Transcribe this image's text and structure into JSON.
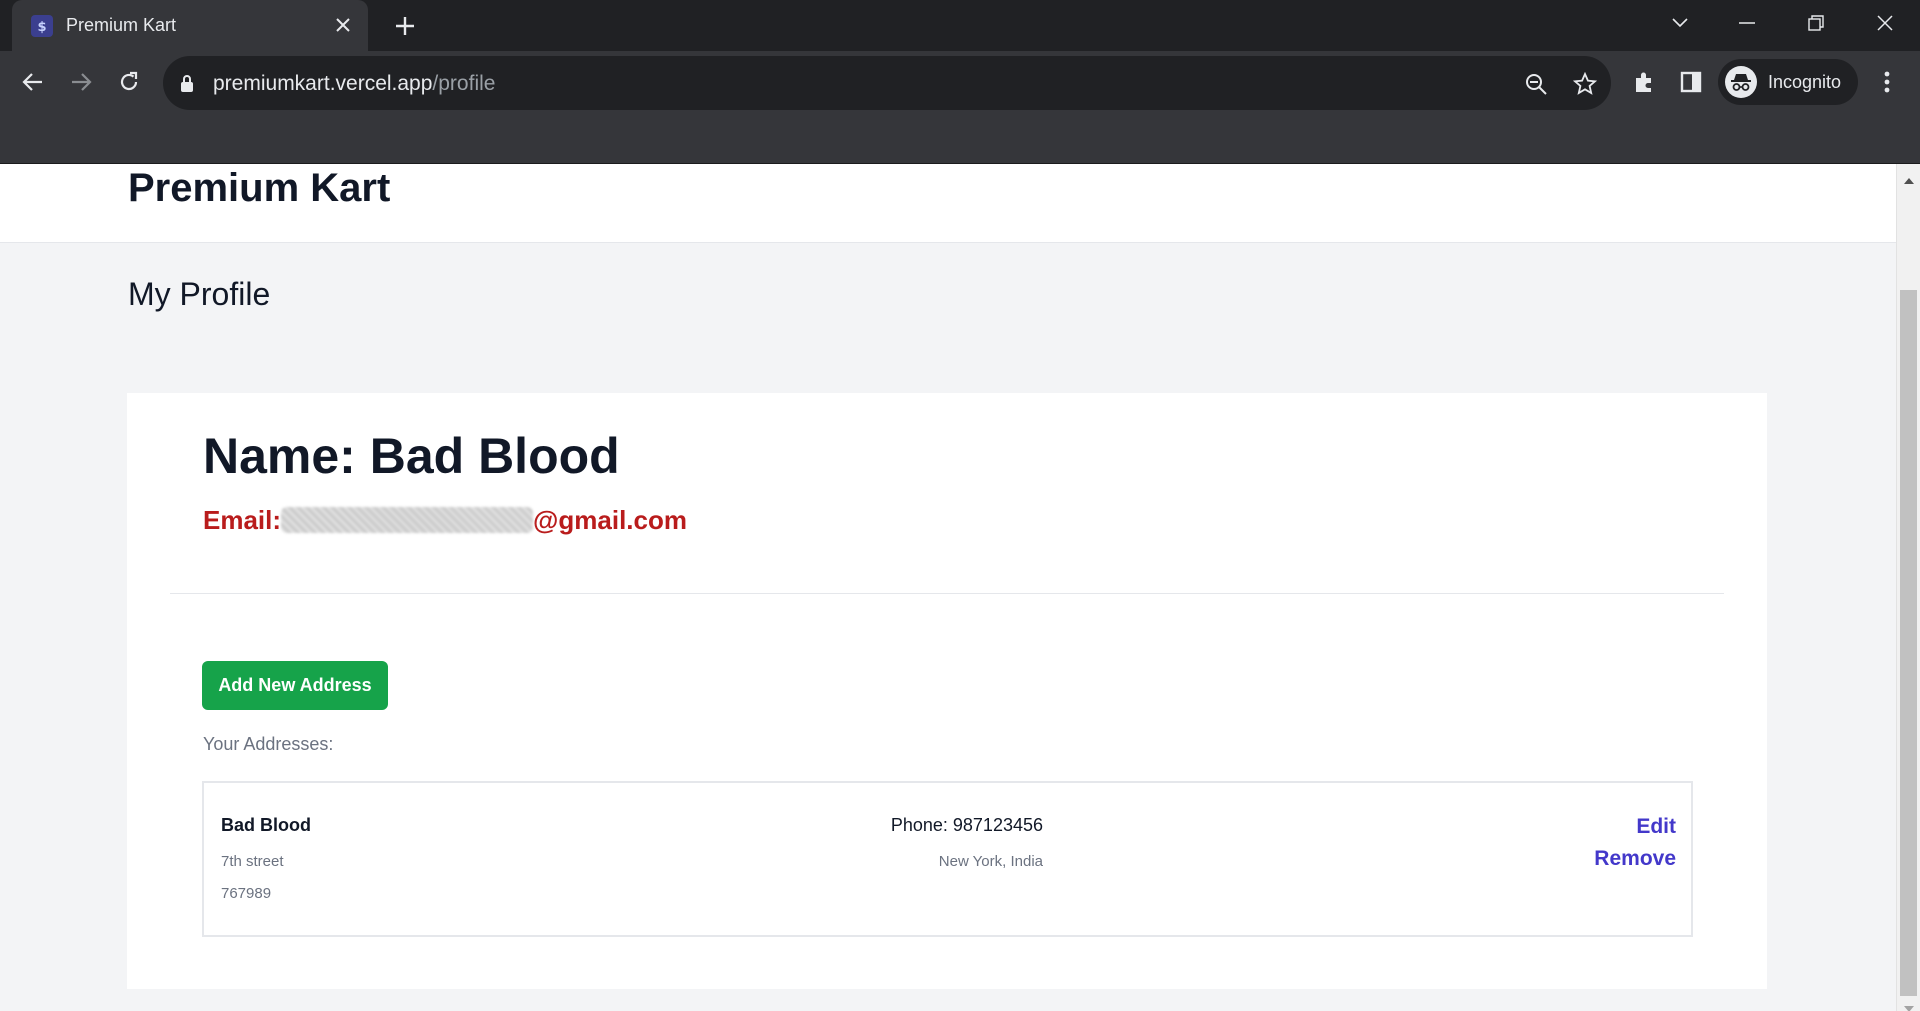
{
  "browser": {
    "tab_title": "Premium Kart",
    "url_host": "premiumkart.vercel.app",
    "url_path": "/profile",
    "profile_label": "Incognito",
    "icons": [
      "back-icon",
      "forward-icon",
      "reload-icon",
      "lock-icon",
      "zoom-out-icon",
      "star-icon",
      "extensions-icon",
      "side-panel-icon",
      "incognito-icon",
      "menu-icon"
    ]
  },
  "site": {
    "brand": "Premium Kart",
    "page_title": "My Profile"
  },
  "profile": {
    "name_text": "Name: Bad Blood",
    "email_label": "Email:",
    "email_domain": "@gmail.com",
    "add_address_label": "Add New Address",
    "addresses_heading": "Your Addresses:"
  },
  "addresses": [
    {
      "name": "Bad Blood",
      "street": "7th street",
      "pincode": "767989",
      "phone": "Phone: 987123456",
      "city_country": "New York, India",
      "edit_label": "Edit",
      "remove_label": "Remove"
    }
  ],
  "colors": {
    "primary_button": "#16a34a",
    "email_text": "#b91c1c",
    "action_link": "#4338ca"
  }
}
